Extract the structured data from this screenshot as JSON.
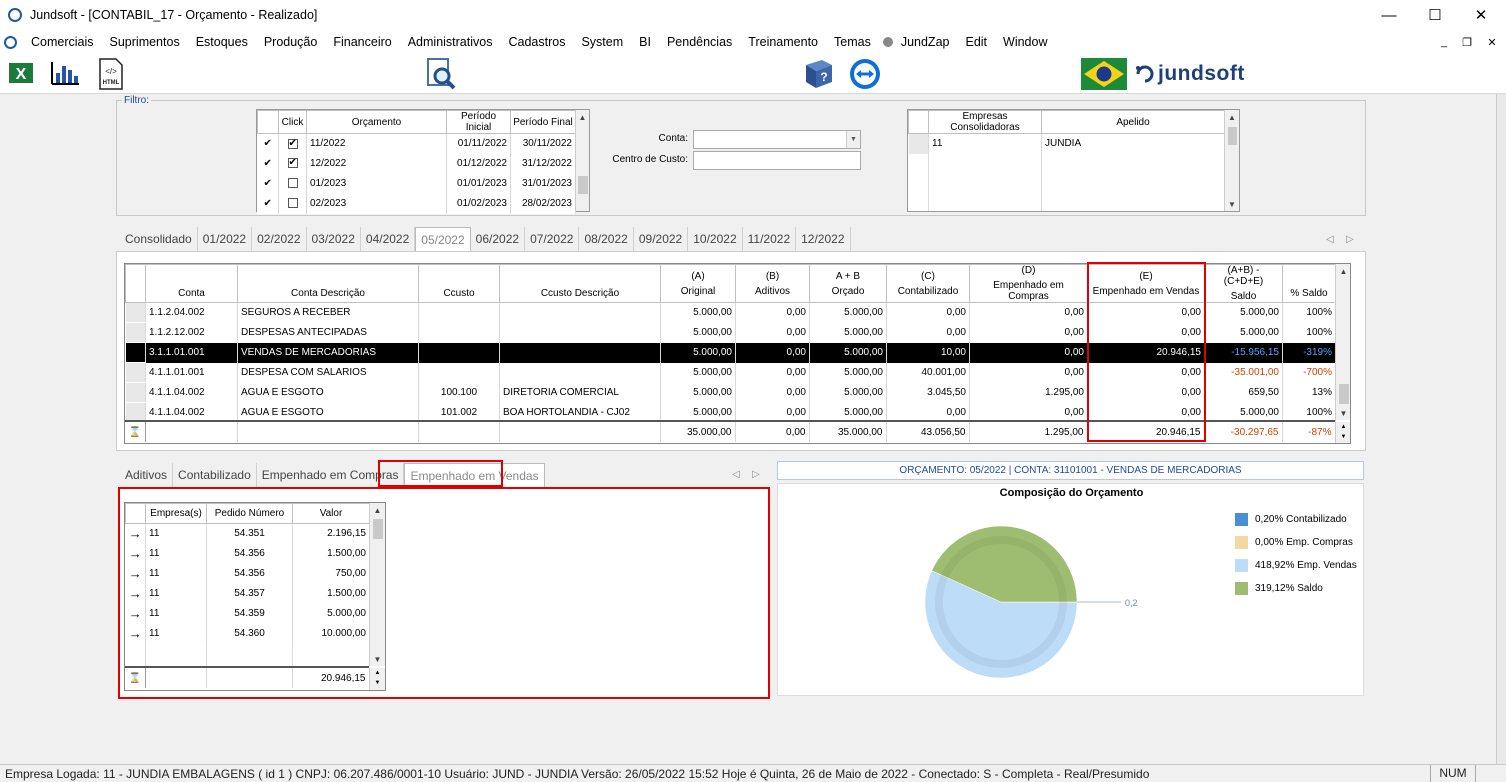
{
  "window": {
    "title": "Jundsoft - [CONTABIL_17 - Orçamento - Realizado]",
    "controls": {
      "minimize": "—",
      "maximize": "☐",
      "close": "✕"
    }
  },
  "menu": {
    "items": [
      "Comerciais",
      "Suprimentos",
      "Estoques",
      "Produção",
      "Financeiro",
      "Administrativos",
      "Cadastros",
      "System",
      "BI",
      "Pendências",
      "Treinamento",
      "Temas",
      "JundZap",
      "Edit",
      "Window"
    ],
    "mdi_controls": {
      "minimize": "_",
      "restore": "❐",
      "close": "✕"
    }
  },
  "toolbar": {
    "brand": "jundsoft",
    "icons": [
      "excel-icon",
      "chart-icon",
      "html-icon",
      "search-report-icon",
      "help-book-icon",
      "teamviewer-icon",
      "brazil-flag-icon"
    ],
    "html_label": "HTML"
  },
  "filter": {
    "legend": "Filtro:",
    "periods": {
      "headers": [
        "Click",
        "Orçamento",
        "Período Inicial",
        "Período Final"
      ],
      "rows": [
        {
          "checked": true,
          "orcamento": "11/2022",
          "inicio": "01/11/2022",
          "fim": "30/11/2022"
        },
        {
          "checked": true,
          "orcamento": "12/2022",
          "inicio": "01/12/2022",
          "fim": "31/12/2022"
        },
        {
          "checked": false,
          "orcamento": "01/2023",
          "inicio": "01/01/2023",
          "fim": "31/01/2023"
        },
        {
          "checked": false,
          "orcamento": "02/2023",
          "inicio": "01/02/2023",
          "fim": "28/02/2023"
        }
      ]
    },
    "conta_label": "Conta:",
    "conta_value": "",
    "centro_custo_label": "Centro de Custo:",
    "centro_custo_value": "",
    "empresas": {
      "headers": [
        "Empresas Consolidadoras",
        "Apelido"
      ],
      "rows": [
        {
          "codigo": "11",
          "apelido": "JUNDIA"
        }
      ]
    }
  },
  "month_tabs": {
    "items": [
      "Consolidado",
      "01/2022",
      "02/2022",
      "03/2022",
      "04/2022",
      "05/2022",
      "06/2022",
      "07/2022",
      "08/2022",
      "09/2022",
      "10/2022",
      "11/2022",
      "12/2022"
    ],
    "active": "05/2022"
  },
  "main_grid": {
    "headers": [
      {
        "top": "",
        "bottom": "Conta"
      },
      {
        "top": "",
        "bottom": "Conta Descrição"
      },
      {
        "top": "",
        "bottom": "Ccusto"
      },
      {
        "top": "",
        "bottom": "Ccusto Descrição"
      },
      {
        "top": "(A)",
        "bottom": "Original"
      },
      {
        "top": "(B)",
        "bottom": "Aditivos"
      },
      {
        "top": "A + B",
        "bottom": "Orçado"
      },
      {
        "top": "(C)",
        "bottom": "Contabilizado"
      },
      {
        "top": "(D)",
        "bottom": "Empenhado em Compras"
      },
      {
        "top": "(E)",
        "bottom": "Empenhado em Vendas"
      },
      {
        "top": "(A+B) - (C+D+E)",
        "bottom": "Saldo"
      },
      {
        "top": "",
        "bottom": "% Saldo"
      }
    ],
    "rows": [
      {
        "conta": "1.1.2.04.002",
        "descricao": "SEGUROS A RECEBER",
        "ccusto": "",
        "ccusto_desc": "",
        "original": "5.000,00",
        "aditivos": "0,00",
        "orcado": "5.000,00",
        "contabilizado": "0,00",
        "emp_compras": "0,00",
        "emp_vendas": "0,00",
        "saldo": "5.000,00",
        "pct": "100%",
        "neg": false,
        "selected": false
      },
      {
        "conta": "1.1.2.12.002",
        "descricao": "DESPESAS  ANTECIPADAS",
        "ccusto": "",
        "ccusto_desc": "",
        "original": "5.000,00",
        "aditivos": "0,00",
        "orcado": "5.000,00",
        "contabilizado": "0,00",
        "emp_compras": "0,00",
        "emp_vendas": "0,00",
        "saldo": "5.000,00",
        "pct": "100%",
        "neg": false,
        "selected": false
      },
      {
        "conta": "3.1.1.01.001",
        "descricao": "VENDAS DE MERCADORIAS",
        "ccusto": "",
        "ccusto_desc": "",
        "original": "5.000,00",
        "aditivos": "0,00",
        "orcado": "5.000,00",
        "contabilizado": "10,00",
        "emp_compras": "0,00",
        "emp_vendas": "20.946,15",
        "saldo": "-15.956,15",
        "pct": "-319%",
        "neg": true,
        "selected": true
      },
      {
        "conta": "4.1.1.01.001",
        "descricao": "DESPESA COM SALARIOS",
        "ccusto": "",
        "ccusto_desc": "",
        "original": "5.000,00",
        "aditivos": "0,00",
        "orcado": "5.000,00",
        "contabilizado": "40.001,00",
        "emp_compras": "0,00",
        "emp_vendas": "0,00",
        "saldo": "-35.001,00",
        "pct": "-700%",
        "neg": true,
        "selected": false
      },
      {
        "conta": "4.1.1.04.002",
        "descricao": "AGUA E ESGOTO",
        "ccusto": "100.100",
        "ccusto_desc": "DIRETORIA COMERCIAL",
        "original": "5.000,00",
        "aditivos": "0,00",
        "orcado": "5.000,00",
        "contabilizado": "3.045,50",
        "emp_compras": "1.295,00",
        "emp_vendas": "0,00",
        "saldo": "659,50",
        "pct": "13%",
        "neg": false,
        "selected": false
      },
      {
        "conta": "4.1.1.04.002",
        "descricao": "AGUA E ESGOTO",
        "ccusto": "101.002",
        "ccusto_desc": "BOA HORTOLANDIA - CJ02",
        "original": "5.000,00",
        "aditivos": "0,00",
        "orcado": "5.000,00",
        "contabilizado": "0,00",
        "emp_compras": "0,00",
        "emp_vendas": "0,00",
        "saldo": "5.000,00",
        "pct": "100%",
        "neg": false,
        "selected": false
      }
    ],
    "totals": {
      "original": "35.000,00",
      "aditivos": "0,00",
      "orcado": "35.000,00",
      "contabilizado": "43.056,50",
      "emp_compras": "1.295,00",
      "emp_vendas": "20.946,15",
      "saldo": "-30.297,65",
      "pct": "-87%"
    }
  },
  "detail_tabs": {
    "items": [
      "Aditivos",
      "Contabilizado",
      "Empenhado em Compras",
      "Empenhado em Vendas"
    ],
    "active": "Empenhado em Vendas"
  },
  "detail_grid": {
    "headers": [
      "Empresa(s)",
      "Pedido Número",
      "Valor"
    ],
    "rows": [
      {
        "empresa": "11",
        "pedido": "54.351",
        "valor": "2.196,15"
      },
      {
        "empresa": "11",
        "pedido": "54.356",
        "valor": "1.500,00"
      },
      {
        "empresa": "11",
        "pedido": "54.356",
        "valor": "750,00"
      },
      {
        "empresa": "11",
        "pedido": "54.357",
        "valor": "1.500,00"
      },
      {
        "empresa": "11",
        "pedido": "54.359",
        "valor": "5.000,00"
      },
      {
        "empresa": "11",
        "pedido": "54.360",
        "valor": "10.000,00"
      }
    ],
    "total": "20.946,15"
  },
  "chart_panel": {
    "header": "ORÇAMENTO: 05/2022 | CONTA: 31101001 - VENDAS DE MERCADORIAS",
    "title": "Composição do Orçamento",
    "callout": "0,2"
  },
  "chart_data": {
    "type": "pie",
    "title": "Composição do Orçamento",
    "categories": [
      "Contabilizado",
      "Emp. Compras",
      "Emp. Vendas",
      "Saldo"
    ],
    "legend": [
      "0,20% Contabilizado",
      "0,00% Emp. Compras",
      "418,92% Emp. Vendas",
      "319,12% Saldo"
    ],
    "values": [
      0.2,
      0.0,
      418.92,
      319.12
    ],
    "colors": [
      "#4a8fd4",
      "#f3d9a0",
      "#bcdcf7",
      "#9fbd70"
    ],
    "legend_position": "right"
  },
  "statusbar": {
    "text": "Empresa Logada: 11 - JUNDIA EMBALAGENS ( id 1 ) CNPJ: 06.207.486/0001-10   Usuário: JUND - JUNDIA    Versão: 26/05/2022 15:52    Hoje é Quinta, 26 de Maio de 2022 - Conectado: S - Completa - Real/Presumido",
    "num": "NUM"
  }
}
